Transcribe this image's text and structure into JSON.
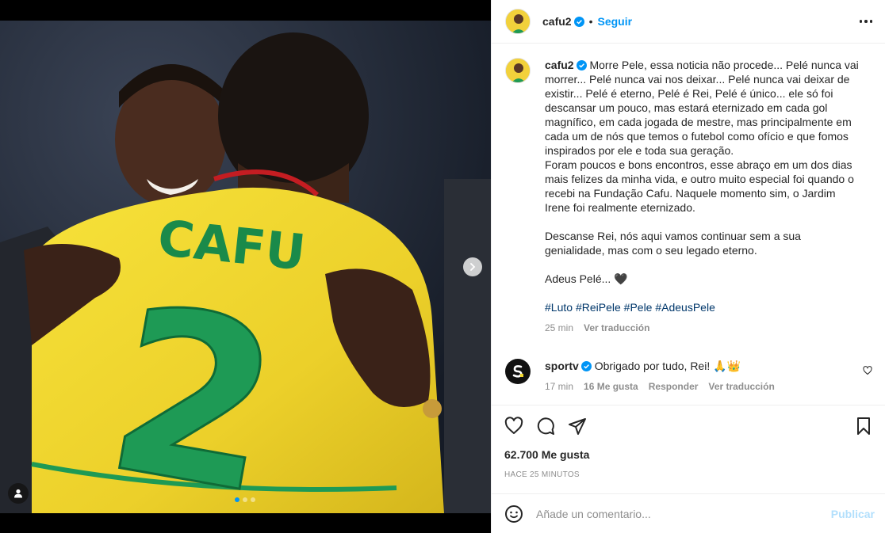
{
  "post": {
    "username": "cafu2",
    "follow_label": "Seguir",
    "caption_text": "Morre Pele, essa noticia não procede... Pelé nunca vai morrer... Pelé nunca vai nos deixar... Pelé nunca vai deixar de existir... Pelé é eterno, Pelé é Rei, Pelé é único... ele só foi descansar um pouco, mas estará eternizado em cada gol magnífico, em cada jogada de mestre, mas principalmente em cada um de nós que temos o futebol como ofício e que fomos inspirados por ele e toda sua geração.\nForam poucos e bons encontros, esse abraço em um dos dias mais felizes da minha vida, e outro muito especial foi quando o recebi na Fundação Cafu. Naquele momento sim, o Jardim Irene foi realmente eternizado.\n\nDescanse Rei, nós aqui vamos continuar sem a sua genialidade, mas com o seu legado eterno.\n\nAdeus Pelé... 🖤",
    "hashtags": [
      "#Luto",
      "#ReiPele",
      "#Pele",
      "#AdeusPele"
    ],
    "caption_time": "25 min",
    "translate_label": "Ver traducción",
    "jersey_name": "CAFU",
    "jersey_number": "2"
  },
  "comment": {
    "username": "sportv",
    "text": "Obrigado por tudo, Rei! 🙏👑",
    "time": "17 min",
    "likes": "16 Me gusta",
    "reply_label": "Responder",
    "translate_label": "Ver traducción"
  },
  "stats": {
    "likes": "62.700 Me gusta",
    "posted": "HACE 25 MINUTOS"
  },
  "composer": {
    "placeholder": "Añade un comentario...",
    "publish_label": "Publicar"
  },
  "colors": {
    "accent": "#0095f6",
    "jersey_yellow": "#f3d82c",
    "jersey_green": "#1e9a55"
  },
  "icons": [
    "chevron-right-icon",
    "user-tag-icon",
    "verified-icon",
    "more-icon",
    "heart-icon",
    "comment-icon",
    "share-icon",
    "bookmark-icon",
    "emoji-icon"
  ]
}
